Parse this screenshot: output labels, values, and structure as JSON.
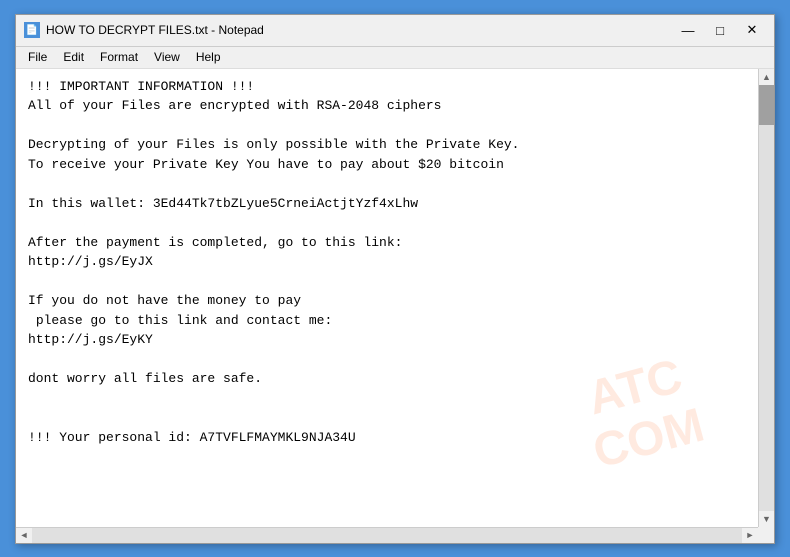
{
  "window": {
    "title": "HOW TO DECRYPT FILES.txt - Notepad",
    "icon_label": "N"
  },
  "title_controls": {
    "minimize": "—",
    "maximize": "□",
    "close": "✕"
  },
  "menu": {
    "items": [
      "File",
      "Edit",
      "Format",
      "View",
      "Help"
    ]
  },
  "content": {
    "text": "!!! IMPORTANT INFORMATION !!!\nAll of your Files are encrypted with RSA-2048 ciphers\n\nDecrypting of your Files is only possible with the Private Key.\nTo receive your Private Key You have to pay about $20 bitcoin\n\nIn this wallet: 3Ed44Tk7tbZLyue5CrneiActjtYzf4xLhw\n\nAfter the payment is completed, go to this link:\nhttp://j.gs/EyJX\n\nIf you do not have the money to pay\n please go to this link and contact me:\nhttp://j.gs/EyKY\n\ndont worry all files are safe.\n\n\n!!! Your personal id: A7TVFLFMAYMKL9NJA34U"
  },
  "watermark": {
    "line1": "ATC",
    "line2": "COM"
  }
}
